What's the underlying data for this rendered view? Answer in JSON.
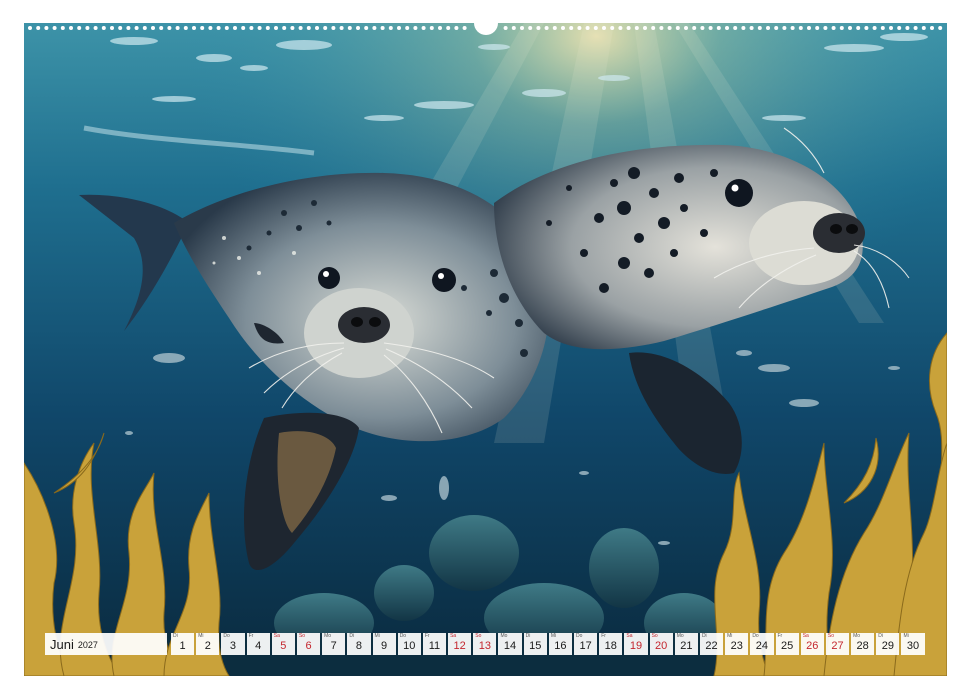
{
  "calendar": {
    "month": "Juni",
    "year": "2027",
    "days": [
      {
        "wd": "Di",
        "n": "1",
        "we": false
      },
      {
        "wd": "Mi",
        "n": "2",
        "we": false
      },
      {
        "wd": "Do",
        "n": "3",
        "we": false
      },
      {
        "wd": "Fr",
        "n": "4",
        "we": false
      },
      {
        "wd": "Sa",
        "n": "5",
        "we": true
      },
      {
        "wd": "So",
        "n": "6",
        "we": true
      },
      {
        "wd": "Mo",
        "n": "7",
        "we": false
      },
      {
        "wd": "Di",
        "n": "8",
        "we": false
      },
      {
        "wd": "Mi",
        "n": "9",
        "we": false
      },
      {
        "wd": "Do",
        "n": "10",
        "we": false
      },
      {
        "wd": "Fr",
        "n": "11",
        "we": false
      },
      {
        "wd": "Sa",
        "n": "12",
        "we": true
      },
      {
        "wd": "So",
        "n": "13",
        "we": true
      },
      {
        "wd": "Mo",
        "n": "14",
        "we": false
      },
      {
        "wd": "Di",
        "n": "15",
        "we": false
      },
      {
        "wd": "Mi",
        "n": "16",
        "we": false
      },
      {
        "wd": "Do",
        "n": "17",
        "we": false
      },
      {
        "wd": "Fr",
        "n": "18",
        "we": false
      },
      {
        "wd": "Sa",
        "n": "19",
        "we": true
      },
      {
        "wd": "So",
        "n": "20",
        "we": true
      },
      {
        "wd": "Mo",
        "n": "21",
        "we": false
      },
      {
        "wd": "Di",
        "n": "22",
        "we": false
      },
      {
        "wd": "Mi",
        "n": "23",
        "we": false
      },
      {
        "wd": "Do",
        "n": "24",
        "we": false
      },
      {
        "wd": "Fr",
        "n": "25",
        "we": false
      },
      {
        "wd": "Sa",
        "n": "26",
        "we": true
      },
      {
        "wd": "So",
        "n": "27",
        "we": true
      },
      {
        "wd": "Mo",
        "n": "28",
        "we": false
      },
      {
        "wd": "Di",
        "n": "29",
        "we": false
      },
      {
        "wd": "Mi",
        "n": "30",
        "we": false
      }
    ]
  },
  "colors": {
    "weekend": "#c4262e",
    "water_deep": "#0b2c4a",
    "water_light": "#2a8fb0",
    "kelp": "#c9a23a"
  }
}
